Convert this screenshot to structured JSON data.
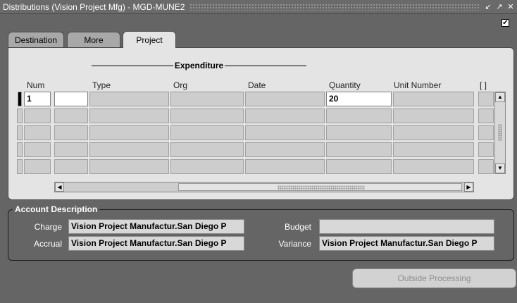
{
  "window": {
    "title": "Distributions (Vision Project Mfg) - MGD-MUNE2",
    "controls": [
      "minimize-icon",
      "maximize-icon",
      "close-icon"
    ]
  },
  "header_checkbox": {
    "checked": true
  },
  "tabs": [
    {
      "label": "Destination",
      "active": false
    },
    {
      "label": "More",
      "active": false
    },
    {
      "label": "Project",
      "active": true
    }
  ],
  "grid": {
    "group_label": "Expenditure",
    "columns": {
      "num": "Num",
      "type": "Type",
      "org": "Org",
      "date": "Date",
      "quantity": "Quantity",
      "unit_number": "Unit Number",
      "flex": "[ ]"
    },
    "rows": [
      {
        "num": "1",
        "extra": "",
        "type": "",
        "org": "",
        "date": "",
        "quantity": "20",
        "unit_number": ""
      },
      {
        "num": "",
        "extra": "",
        "type": "",
        "org": "",
        "date": "",
        "quantity": "",
        "unit_number": ""
      },
      {
        "num": "",
        "extra": "",
        "type": "",
        "org": "",
        "date": "",
        "quantity": "",
        "unit_number": ""
      },
      {
        "num": "",
        "extra": "",
        "type": "",
        "org": "",
        "date": "",
        "quantity": "",
        "unit_number": ""
      },
      {
        "num": "",
        "extra": "",
        "type": "",
        "org": "",
        "date": "",
        "quantity": "",
        "unit_number": ""
      }
    ]
  },
  "account_description": {
    "title": "Account Description",
    "charge_label": "Charge",
    "charge_value": "Vision Project Manufactur.San Diego P",
    "accrual_label": "Accrual",
    "accrual_value": "Vision Project Manufactur.San Diego P",
    "budget_label": "Budget",
    "budget_value": "",
    "variance_label": "Variance",
    "variance_value": "Vision Project Manufactur.San Diego P"
  },
  "buttons": {
    "outside_processing": "Outside Processing"
  }
}
